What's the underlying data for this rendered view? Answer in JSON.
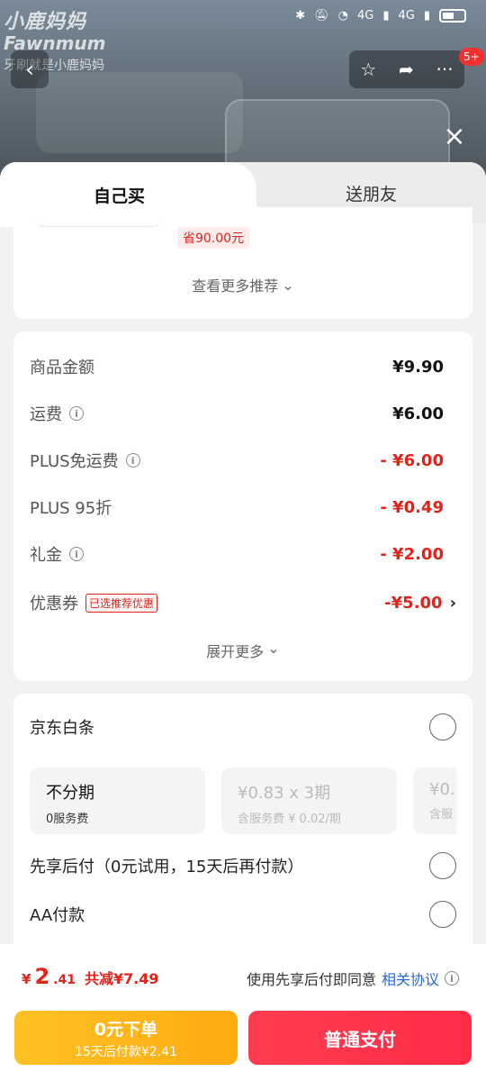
{
  "watermark": {
    "brand_cn": "小鹿妈妈",
    "brand_en": "Fawnmum",
    "caption": "牙刷就是小鹿妈妈"
  },
  "status_bar": {
    "network": "4G",
    "network2": "4G",
    "icons": [
      "bluetooth-icon",
      "mute-icon",
      "wifi-icon",
      "signal-icon",
      "battery-icon"
    ]
  },
  "nav": {
    "back_icon": "‹",
    "star_icon": "☆",
    "share_icon": "➦",
    "more_icon": "···",
    "badge": "5+",
    "close_icon": "×"
  },
  "tabs": {
    "buy_self": "自己买",
    "gift": "送朋友"
  },
  "recommend": {
    "save_tag": "省90.00元",
    "more_label": "查看更多推荐",
    "chevron": "⌄"
  },
  "price_rows": [
    {
      "label": "商品金额",
      "value": "¥9.90",
      "info": false,
      "red": false
    },
    {
      "label": "运费",
      "value": "¥6.00",
      "info": true,
      "red": false
    },
    {
      "label": "PLUS免运费",
      "value": "- ¥6.00",
      "info": true,
      "red": true
    },
    {
      "label": "PLUS 95折",
      "value": "- ¥0.49",
      "info": false,
      "red": true
    },
    {
      "label": "礼金",
      "value": "- ¥2.00",
      "info": true,
      "red": true
    },
    {
      "label": "优惠券",
      "value": "-¥5.00",
      "info": false,
      "red": true,
      "tag": "已选推荐优惠",
      "chevron": "›"
    }
  ],
  "expand": {
    "label": "展开更多",
    "chevron": "⌄"
  },
  "payment": {
    "baitiao": "京东白条",
    "installments": [
      {
        "title": "不分期",
        "sub": "0服务费",
        "disabled": false
      },
      {
        "title": "¥0.83 x 3期",
        "sub": "含服务费 ¥ 0.02/期",
        "disabled": true
      },
      {
        "title": "¥0.",
        "sub": "含服",
        "disabled": true
      }
    ],
    "pay_later": "先享后付（0元试用，15天后再付款）",
    "aa": "AA付款"
  },
  "bottom": {
    "currency": "¥",
    "amount_int": "2",
    "amount_dec": ".41",
    "reduce": "共减¥7.49",
    "agree_text": "使用先享后付即同意",
    "agree_link": "相关协议",
    "zero_btn_title": "0元下单",
    "zero_btn_sub": "15天后付款¥2.41",
    "normal_btn": "普通支付"
  },
  "colors": {
    "accent_red": "#e2231a",
    "link_blue": "#2b6ad6",
    "yellow_btn": "#ffb516",
    "red_btn": "#ff3450"
  }
}
